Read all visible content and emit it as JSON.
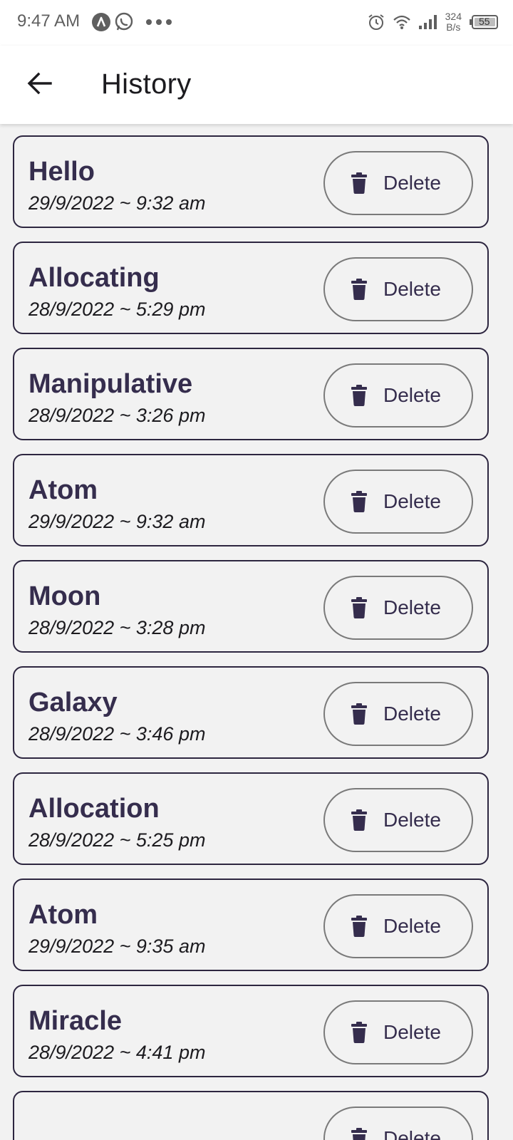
{
  "status_bar": {
    "time": "9:47 AM",
    "net_speed_value": "324",
    "net_speed_unit": "B/s",
    "battery": "55",
    "icons": [
      "a-app-icon",
      "whatsapp-icon",
      "more-dots-icon",
      "alarm-icon",
      "wifi-icon",
      "signal-icon",
      "battery-icon"
    ]
  },
  "app_bar": {
    "title": "History",
    "back_icon": "arrow-left-icon"
  },
  "history": {
    "delete_label": "Delete",
    "items": [
      {
        "title": "Hello",
        "date": "29/9/2022 ~ 9:32 am"
      },
      {
        "title": "Allocating",
        "date": "28/9/2022 ~ 5:29 pm"
      },
      {
        "title": "Manipulative",
        "date": "28/9/2022 ~ 3:26 pm"
      },
      {
        "title": "Atom",
        "date": "29/9/2022 ~ 9:32 am"
      },
      {
        "title": "Moon",
        "date": "28/9/2022 ~ 3:28 pm"
      },
      {
        "title": "Galaxy",
        "date": "28/9/2022 ~ 3:46 pm"
      },
      {
        "title": "Allocation",
        "date": "28/9/2022 ~ 5:25 pm"
      },
      {
        "title": "Atom",
        "date": "29/9/2022 ~ 9:35 am"
      },
      {
        "title": "Miracle",
        "date": "28/9/2022 ~ 4:41 pm"
      },
      {
        "title": "",
        "date": ""
      }
    ]
  },
  "colors": {
    "accent": "#352d4d",
    "card_border": "#2d2640",
    "background": "#f2f2f2"
  }
}
